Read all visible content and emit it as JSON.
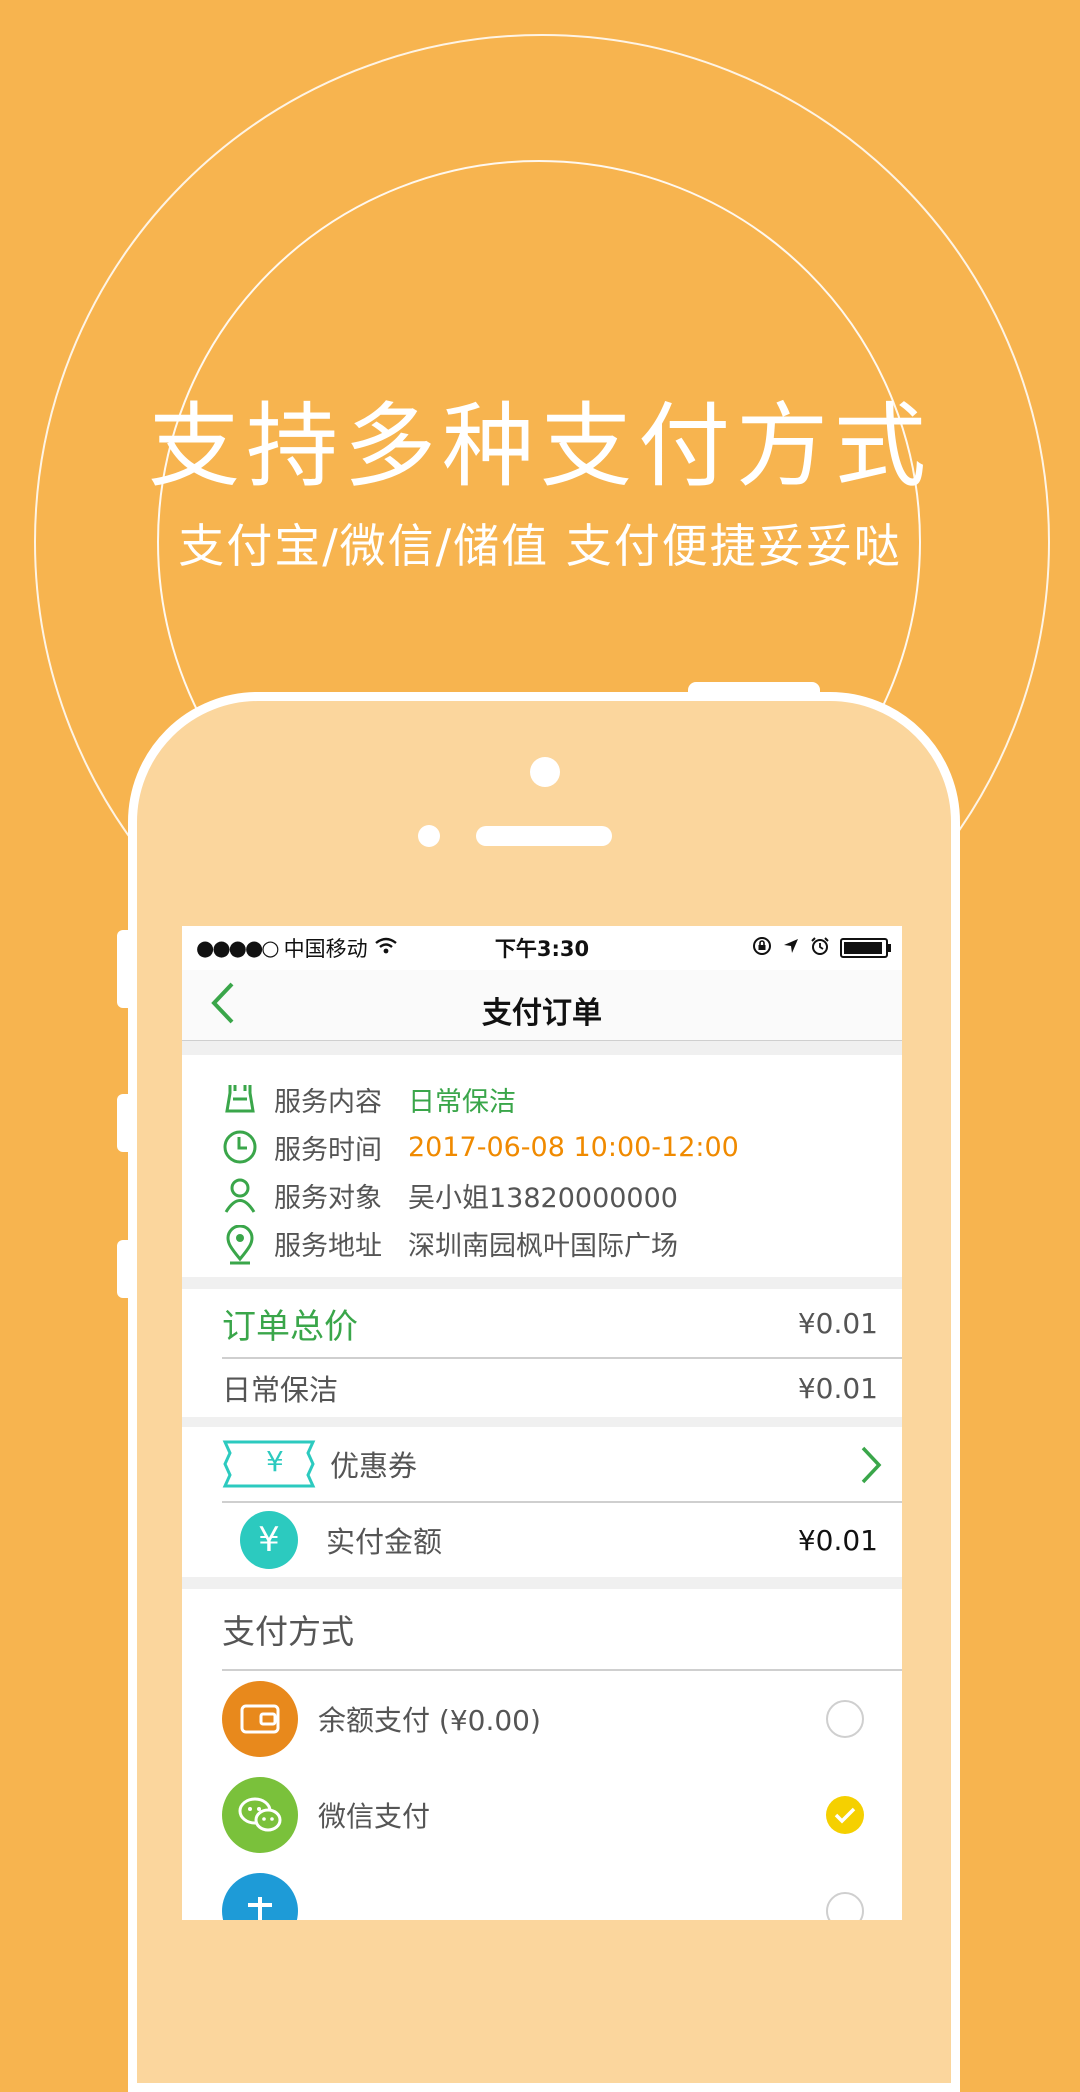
{
  "hero": {
    "title": "支持多种支付方式",
    "subtitle": "支付宝/微信/储值 支付便捷妥妥哒"
  },
  "status_bar": {
    "signal": "●●●●○",
    "carrier": "中国移动",
    "time": "下午3:30",
    "battery_level": 0.95
  },
  "nav": {
    "back_icon": "chevron-left-icon",
    "title": "支付订单"
  },
  "service_info": [
    {
      "icon": "cleaning-icon",
      "label": "服务内容",
      "value": "日常保洁"
    },
    {
      "icon": "clock-icon",
      "label": "服务时间",
      "value": "2017-06-08 10:00-12:00"
    },
    {
      "icon": "person-icon",
      "label": "服务对象",
      "value": "吴小姐13820000000"
    },
    {
      "icon": "location-icon",
      "label": "服务地址",
      "value": "深圳南园枫叶国际广场"
    }
  ],
  "order": {
    "total_label": "订单总价",
    "total_amount": "¥0.01",
    "item_label": "日常保洁",
    "item_amount": "¥0.01"
  },
  "coupon": {
    "icon_text": "¥",
    "label": "优惠券"
  },
  "actual": {
    "icon_text": "¥",
    "label": "实付金额",
    "amount": "¥0.01"
  },
  "payment": {
    "section_title": "支付方式",
    "methods": [
      {
        "icon": "wallet-icon",
        "label": "余额支付 (¥0.00)",
        "selected": false,
        "color": "#e8891c"
      },
      {
        "icon": "wechat-icon",
        "label": "微信支付",
        "selected": true,
        "color": "#7ac13b"
      },
      {
        "icon": "alipay-icon",
        "label": "",
        "selected": false,
        "color": "#1e9bd7"
      }
    ]
  },
  "colors": {
    "background": "#f7b44f",
    "accent_green": "#3aa64a",
    "accent_orange": "#f08a00",
    "teal": "#2ccabf",
    "check_yellow": "#f5d000"
  }
}
